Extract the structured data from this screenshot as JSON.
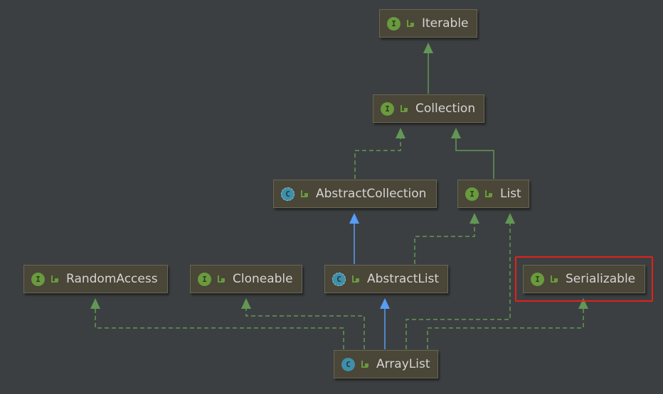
{
  "diagram": {
    "nodes": {
      "iterable": {
        "label": "Iterable",
        "kind": "interface"
      },
      "collection": {
        "label": "Collection",
        "kind": "interface"
      },
      "abstract_collection": {
        "label": "AbstractCollection",
        "kind": "abstract-class"
      },
      "list": {
        "label": "List",
        "kind": "interface"
      },
      "random_access": {
        "label": "RandomAccess",
        "kind": "interface"
      },
      "cloneable": {
        "label": "Cloneable",
        "kind": "interface"
      },
      "abstract_list": {
        "label": "AbstractList",
        "kind": "abstract-class"
      },
      "serializable": {
        "label": "Serializable",
        "kind": "interface",
        "highlighted": true
      },
      "array_list": {
        "label": "ArrayList",
        "kind": "class"
      }
    },
    "edges": [
      {
        "from": "collection",
        "to": "iterable",
        "style": "extends"
      },
      {
        "from": "abstract_collection",
        "to": "collection",
        "style": "implements"
      },
      {
        "from": "list",
        "to": "collection",
        "style": "extends"
      },
      {
        "from": "abstract_list",
        "to": "abstract_collection",
        "style": "class-extends"
      },
      {
        "from": "abstract_list",
        "to": "list",
        "style": "implements"
      },
      {
        "from": "array_list",
        "to": "abstract_list",
        "style": "class-extends"
      },
      {
        "from": "array_list",
        "to": "list",
        "style": "implements"
      },
      {
        "from": "array_list",
        "to": "random_access",
        "style": "implements"
      },
      {
        "from": "array_list",
        "to": "cloneable",
        "style": "implements"
      },
      {
        "from": "array_list",
        "to": "serializable",
        "style": "implements"
      }
    ],
    "legend_icons": {
      "interface": "interface-icon",
      "class": "class-icon",
      "abstract-class": "abstract-class-icon",
      "visibility": "public-visibility-icon"
    },
    "colors": {
      "background": "#3c3f41",
      "node_fill": "#4a4638",
      "interface_edge": "#629755",
      "class_edge": "#589df6",
      "highlight": "#e3211b"
    }
  }
}
